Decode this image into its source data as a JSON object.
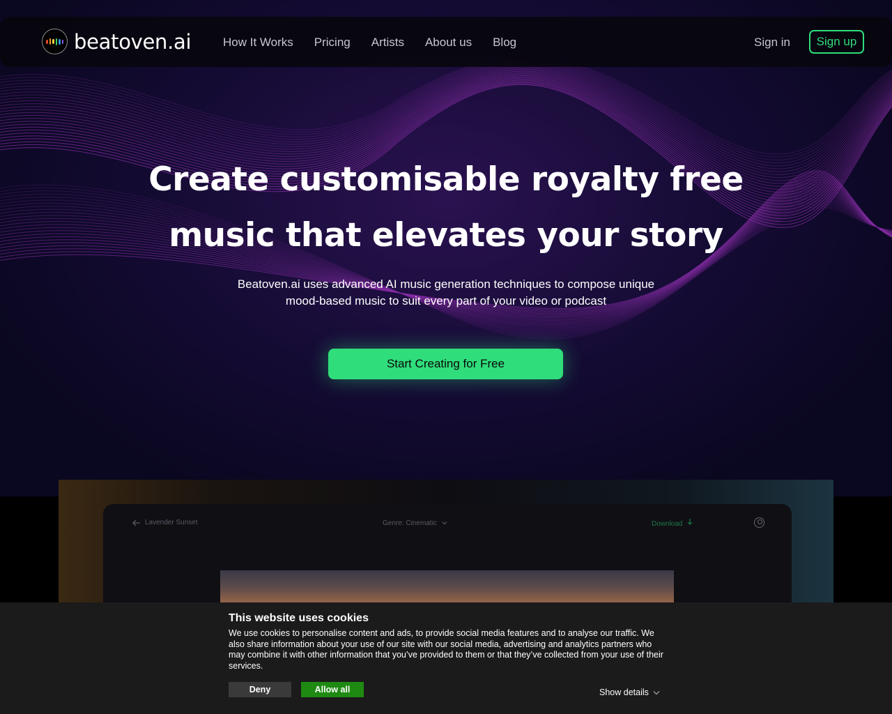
{
  "brand": {
    "name": "beatoven.ai",
    "logo_icon": "equalizer-bars-icon",
    "logo_colors": [
      "#e8452c",
      "#f29a2e",
      "#f4d23a",
      "#3ecf5e",
      "#2f8ff0",
      "#8c55e8"
    ]
  },
  "nav": {
    "links": [
      "How It Works",
      "Pricing",
      "Artists",
      "About us",
      "Blog"
    ],
    "sign_in": "Sign in",
    "sign_up": "Sign up"
  },
  "hero": {
    "headline_line1": "Create customisable royalty free",
    "headline_line2": "music that elevates your story",
    "subtext": "Beatoven.ai uses advanced AI music generation techniques to compose unique mood-based music to suit every part of your video or podcast",
    "cta": "Start Creating for Free"
  },
  "preview": {
    "back_label": "Lavender Sunset",
    "genre_label": "Genre: Cinematic",
    "download_label": "Download",
    "icons": [
      "arrow-left-icon",
      "chevron-down-icon",
      "download-arrow-icon",
      "user-circle-icon"
    ]
  },
  "cookie_banner": {
    "title": "This website uses cookies",
    "body": "We use cookies to personalise content and ads, to provide social media features and to analyse our traffic. We also share information about your use of our site with our social media, advertising and analytics partners who may combine it with other information that you’ve provided to them or that they’ve collected from your use of their services.",
    "deny": "Deny",
    "allow_all": "Allow all",
    "show_details": "Show details"
  },
  "colors": {
    "accent_green": "#2fdd7b",
    "background": "#0b0820",
    "wave_purple": "#8a2ea8",
    "allow_button": "#1f8a12"
  }
}
